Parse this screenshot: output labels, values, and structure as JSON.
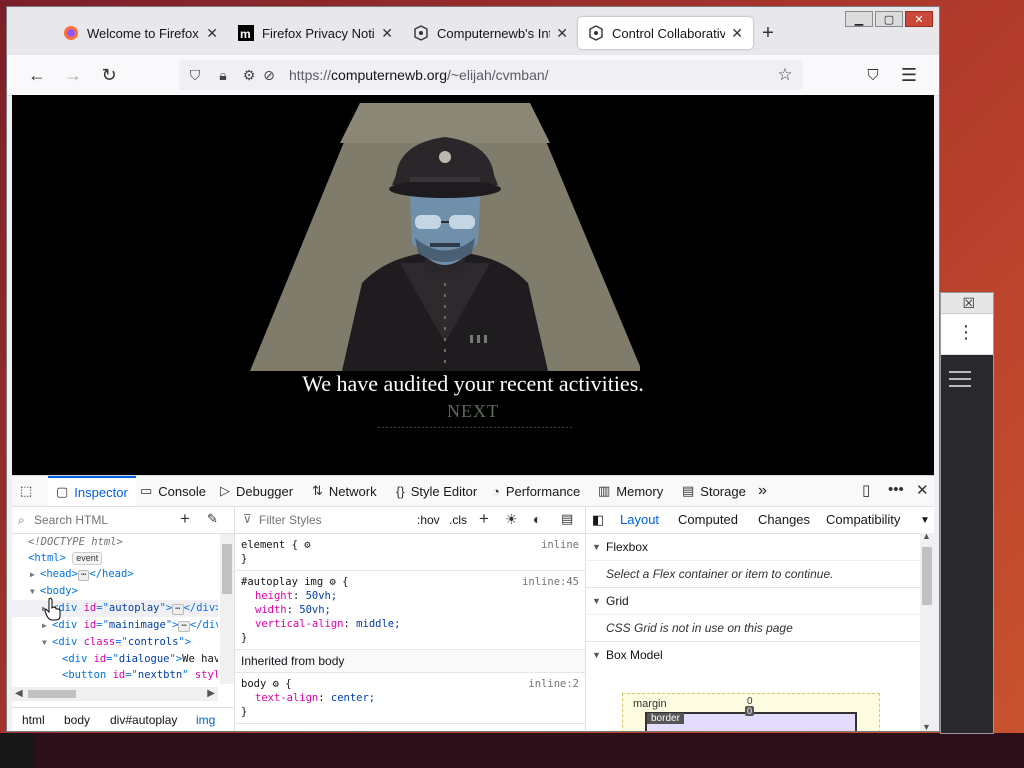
{
  "tabs": [
    {
      "label": "Welcome to Firefox",
      "favicon": "firefox-icon",
      "active": false
    },
    {
      "label": "Firefox Privacy Notice",
      "favicon": "mozilla-icon",
      "active": false
    },
    {
      "label": "Computernewb's Inter",
      "favicon": "page-icon",
      "active": false
    },
    {
      "label": "Control Collaborative",
      "favicon": "page-icon",
      "active": true
    }
  ],
  "url": {
    "prefix": "https://",
    "host": "computernewb.org",
    "path": "/~elijah/cvmban/"
  },
  "page": {
    "dialogue": "We have audited your recent activities.",
    "next_label": "NEXT"
  },
  "devtools": {
    "tabs": {
      "inspector": "Inspector",
      "console": "Console",
      "debugger": "Debugger",
      "network": "Network",
      "style_editor": "Style Editor",
      "performance": "Performance",
      "memory": "Memory",
      "storage": "Storage"
    },
    "html_search_placeholder": "Search HTML",
    "filter_styles_placeholder": "Filter Styles",
    "hov": ":hov",
    "cls": ".cls",
    "tree": {
      "doctype": "<!DOCTYPE html>",
      "html_open": "<html>",
      "event_badge": "event",
      "head": "head",
      "body": "body",
      "div_autoplay": "autoplay",
      "div_mainimage": "mainimage",
      "div_controls": "controls",
      "div_dialogue": "dialogue",
      "dialogue_text": "We have",
      "button_nextbtn": "nextbtn",
      "button_style": "style"
    },
    "breadcrumbs": [
      "html",
      "body",
      "div#autoplay",
      "img"
    ],
    "rules": {
      "element_selector": "element {",
      "element_src": "inline",
      "autoplay_selector": "#autoplay img",
      "autoplay_src": "inline:45",
      "props": [
        {
          "name": "height",
          "value": "50vh;"
        },
        {
          "name": "width",
          "value": "50vh;"
        },
        {
          "name": "vertical-align",
          "value": "middle;"
        }
      ],
      "inherited_label": "Inherited from body",
      "body_selector": "body",
      "body_src": "inline:2",
      "body_prop": {
        "name": "text-align",
        "value": "center;"
      }
    },
    "layout_tabs": {
      "layout": "Layout",
      "computed": "Computed",
      "changes": "Changes",
      "compatibility": "Compatibility"
    },
    "flexbox": {
      "title": "Flexbox",
      "message": "Select a Flex container or item to continue."
    },
    "grid": {
      "title": "Grid",
      "message": "CSS Grid is not in use on this page"
    },
    "boxmodel": {
      "title": "Box Model",
      "margin_label": "margin",
      "border_label": "border",
      "margin_top": "0",
      "border_top": "0"
    }
  },
  "colors": {
    "accent": "#0060df",
    "spotlight": "#7f7c6c",
    "page_bg": "#000000"
  }
}
